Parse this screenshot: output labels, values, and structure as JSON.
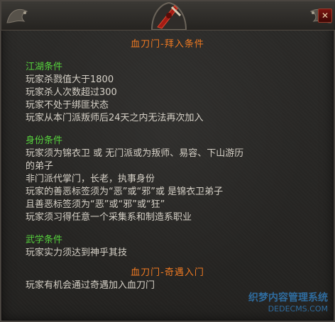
{
  "window": {
    "close_icon": "close-icon",
    "watermark": {
      "line1": "织梦内容管理系统",
      "line2": "DEDECMS.COM"
    }
  },
  "sections": {
    "join_title": "血刀门-拜入条件",
    "jianghu": {
      "title": "江湖条件",
      "lines": [
        "玩家杀戮值大于1800",
        "玩家杀人次数超过300",
        "玩家不处于绑匪状态",
        "玩家从本门派叛师后24天之内无法再次加入"
      ]
    },
    "identity": {
      "title": "身份条件",
      "lines": [
        "玩家须为锦衣卫  或  无门派或为叛师、易容、下山游历",
        "的弟子",
        "非门派代掌门，长老，执事身份",
        "玩家的善恶标签须为“恶”或“邪”或 是锦衣卫弟子",
        "且善恶标签须为“恶”或“邪”或“狂”",
        "玩家须习得任意一个采集系和制造系职业"
      ]
    },
    "martial": {
      "title": "武学条件",
      "lines": [
        "玩家实力须达到神乎其技"
      ]
    },
    "encounter_title": "血刀门-奇遇入门",
    "encounter_lines": [
      "玩家有机会通过奇遇加入血刀门"
    ]
  }
}
